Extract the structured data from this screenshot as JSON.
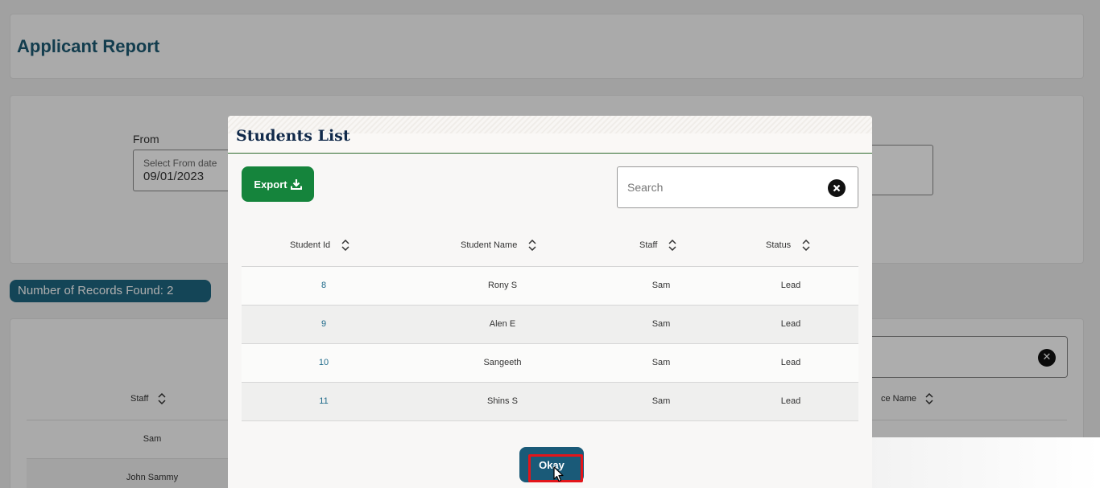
{
  "page": {
    "title": "Applicant Report",
    "filter": {
      "from_label": "From",
      "from_field_label": "Select From date",
      "from_value": "09/01/2023"
    },
    "records_found": "Number of Records Found: 2",
    "background_table": {
      "headers": {
        "staff": "Staff",
        "service_name_partial": "ce Name"
      },
      "rows": [
        {
          "staff": "Sam"
        },
        {
          "staff": "John Sammy"
        }
      ]
    }
  },
  "modal": {
    "title": "Students List",
    "export_label": "Export",
    "search": {
      "placeholder": "Search",
      "value": ""
    },
    "columns": [
      "Student Id",
      "Student Name",
      "Staff",
      "Status"
    ],
    "rows": [
      {
        "id": "8",
        "name": "Rony S",
        "staff": "Sam",
        "status": "Lead"
      },
      {
        "id": "9",
        "name": "Alen E",
        "staff": "Sam",
        "status": "Lead"
      },
      {
        "id": "10",
        "name": "Sangeeth",
        "staff": "Sam",
        "status": "Lead"
      },
      {
        "id": "11",
        "name": "Shins S",
        "staff": "Sam",
        "status": "Lead"
      }
    ],
    "okay_label": "Okay"
  },
  "colors": {
    "accent": "#1e6680",
    "export_green": "#15843c",
    "title_navy": "#10294a",
    "highlight_red": "#e3151a"
  },
  "icons": {
    "sort": "sort-icon",
    "clear": "close-circle-icon",
    "export": "download-icon",
    "cursor": "mouse-pointer-icon"
  }
}
